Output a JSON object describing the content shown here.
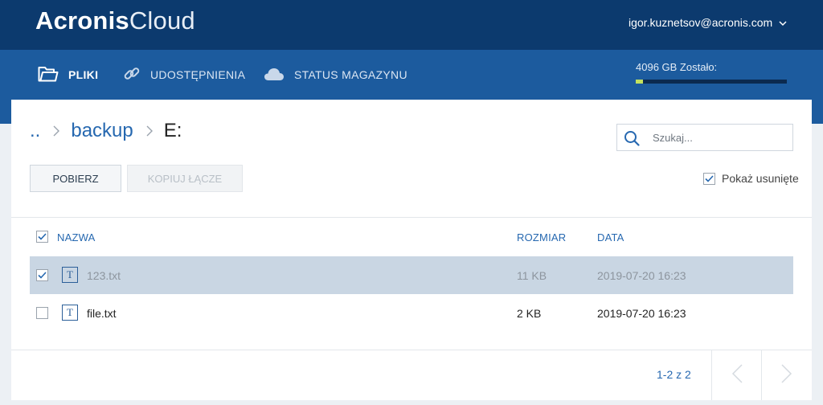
{
  "header": {
    "logo_brand": "Acronis",
    "logo_product": "Cloud",
    "user_email": "igor.kuznetsov@acronis.com"
  },
  "nav": {
    "tabs": [
      {
        "label": "PLIKI",
        "icon": "folder-icon",
        "active": true
      },
      {
        "label": "UDOSTĘPNIENIA",
        "icon": "link-icon",
        "active": false
      },
      {
        "label": "STATUS MAGAZYNU",
        "icon": "cloud-icon",
        "active": false
      }
    ],
    "storage_label": "4096 GB Zostało:",
    "storage_used_fraction": 0.05,
    "storage_fill_color": "#c3e15e"
  },
  "breadcrumb": {
    "items": [
      "..",
      "backup",
      "E:"
    ]
  },
  "search": {
    "placeholder": "Szukaj..."
  },
  "toolbar": {
    "download_label": "POBIERZ",
    "copy_link_label": "KOPIUJ ŁĄCZE"
  },
  "show_deleted": {
    "label": "Pokaż usunięte",
    "checked": true
  },
  "table": {
    "columns": {
      "name": "NAZWA",
      "size": "ROZMIAR",
      "date": "DATA"
    },
    "rows": [
      {
        "name": "123.txt",
        "size": "11 KB",
        "date": "2019-07-20 16:23",
        "checked": true,
        "icon": "text-file-icon"
      },
      {
        "name": "file.txt",
        "size": "2 KB",
        "date": "2019-07-20 16:23",
        "checked": false,
        "icon": "text-file-icon"
      }
    ]
  },
  "pagination": {
    "text": "1-2 z 2"
  },
  "colors": {
    "header_dark": "#0c3a6e",
    "nav_blue": "#1c5b9e",
    "link_blue": "#2668b0",
    "selected_row": "#c9d6e3"
  }
}
